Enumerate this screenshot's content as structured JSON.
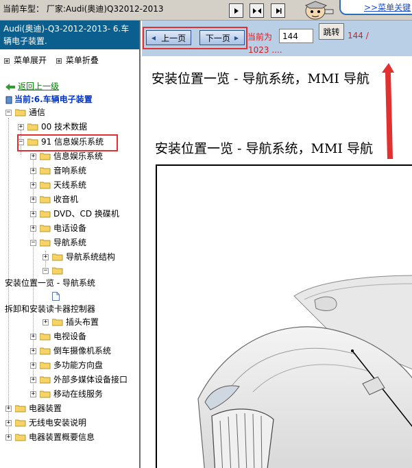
{
  "topbar": {
    "car_label": "当前车型：",
    "car_value": "厂家:Audi(奥迪)Q32012-2013",
    "search_link": ">>菜单关键"
  },
  "left": {
    "header": "Audi(奥迪)-Q3-2012-2013- 6.车辆电子装置.",
    "expand_label": "菜单展开",
    "collapse_label": "菜单折叠",
    "back_label": "返回上一级",
    "current_label": "当前:6.车辆电子装置",
    "tree": [
      {
        "label": "通信",
        "depth": 0
      },
      {
        "label": "00 技术数据",
        "depth": 1
      },
      {
        "label": "91 信息娱乐系统",
        "depth": 1
      },
      {
        "label": "信息娱乐系统",
        "depth": 2
      },
      {
        "label": "音响系统",
        "depth": 2
      },
      {
        "label": "天线系统",
        "depth": 2
      },
      {
        "label": "收音机",
        "depth": 2
      },
      {
        "label": "DVD、CD 换碟机",
        "depth": 2
      },
      {
        "label": "电话设备",
        "depth": 2
      },
      {
        "label": "导航系统",
        "depth": 2
      },
      {
        "label": "导航系统结构",
        "depth": 3
      },
      {
        "label": "",
        "depth": 3
      },
      {
        "label": "安装位置一览 - 导航系统",
        "depth": -1
      },
      {
        "label": "",
        "depth": 4
      },
      {
        "label": "拆卸和安装读卡器控制器",
        "depth": -1
      },
      {
        "label": "插头布置",
        "depth": 3
      },
      {
        "label": "电视设备",
        "depth": 2
      },
      {
        "label": "倒车摄像机系统",
        "depth": 2
      },
      {
        "label": "多功能方向盘",
        "depth": 2
      },
      {
        "label": "外部多媒体设备接口",
        "depth": 2
      },
      {
        "label": "移动在线服务",
        "depth": 2
      },
      {
        "label": "电器装置",
        "depth": 0
      },
      {
        "label": "无线电安装说明",
        "depth": 0
      },
      {
        "label": "电器装置概要信息",
        "depth": 0
      }
    ]
  },
  "nav": {
    "prev_label": "上一页",
    "next_label": "下一页",
    "current_prefix": "当前为",
    "page_value": "144",
    "jump_label": "跳转",
    "total_a": "144 /",
    "total_b": "1023 ...."
  },
  "content": {
    "title1": "安装位置一览 - 导航系统，MMI 导航",
    "title2": "安装位置一览 - 导航系统，MMI 导航"
  },
  "colors": {
    "header_bg": "#0b5f8f",
    "nav_bg": "#b9cfe6",
    "highlight": "#e03030"
  }
}
